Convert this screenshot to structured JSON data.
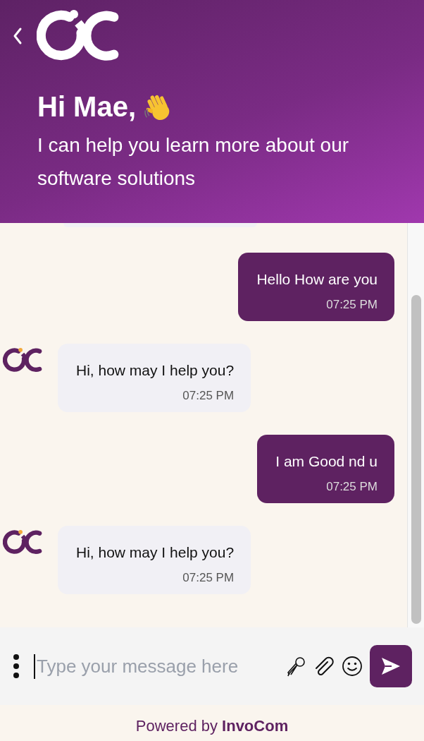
{
  "header": {
    "greeting": "Hi Mae,",
    "subtitle": "I can help you learn more about our software solutions"
  },
  "messages": [
    {
      "kind": "sent",
      "text": "Hello How are you",
      "time": "07:25 PM"
    },
    {
      "kind": "received",
      "text": "Hi, how may I help you?",
      "time": "07:25 PM"
    },
    {
      "kind": "sent",
      "text": "I am Good nd u",
      "time": "07:25 PM"
    },
    {
      "kind": "received",
      "text": "Hi, how may I help you?",
      "time": "07:25 PM"
    }
  ],
  "composer": {
    "placeholder": "Type your message here"
  },
  "footer": {
    "text": "Powered by **InvoCom**"
  }
}
